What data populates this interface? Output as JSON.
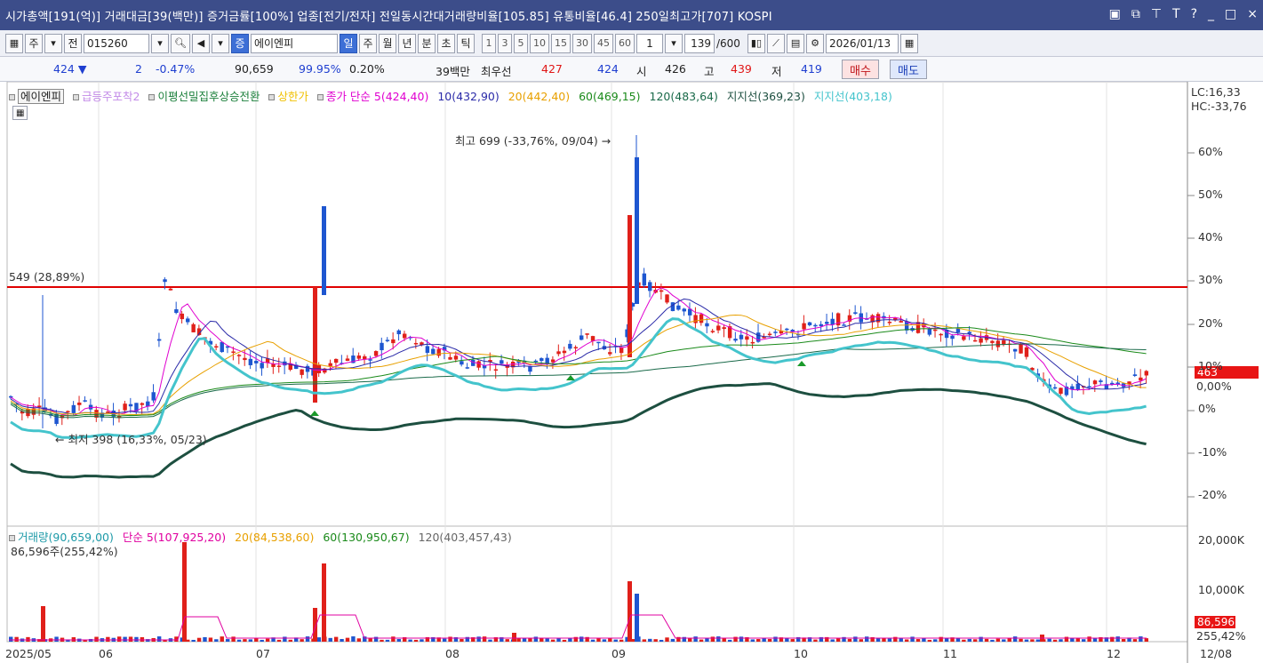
{
  "titlebar": {
    "text": "시가총액[191(억)]  거래대금[39(백만)]  증거금률[100%]  업종[전기/전자]  전일동시간대거래량비율[105.85]  유통비율[46.4]  250일최고가[707]  KOSPI",
    "icons": [
      "window-icon",
      "restore-icon",
      "pin-icon",
      "font-icon",
      "help-icon",
      "minimize-icon",
      "maximize-icon",
      "close-icon"
    ]
  },
  "toolbar": {
    "stock_type": "주",
    "all_label": "전",
    "code": "015260",
    "name": "에이엔피",
    "period_buttons": [
      "일",
      "주",
      "월",
      "년",
      "분",
      "초",
      "틱"
    ],
    "interval_buttons": [
      "1",
      "3",
      "5",
      "10",
      "15",
      "30",
      "45",
      "60"
    ],
    "interval_value": "1",
    "count": "139",
    "count_max": "/600",
    "date": "2026/01/13"
  },
  "quote": {
    "price": "424",
    "change": "2",
    "change_pct": "-0.47%",
    "volume": "90,659",
    "vol_ratio": "99.95%",
    "turnover": "0.20%",
    "amount": "39백만",
    "best_label": "최우선",
    "best_ask": "427",
    "best_bid": "424",
    "open_label": "시",
    "open": "426",
    "high_label": "고",
    "high": "439",
    "low_label": "저",
    "low": "419",
    "buy_label": "매수",
    "sell_label": "매도"
  },
  "legend": {
    "stock": "에이엔피",
    "items": [
      {
        "text": "급등주포착2",
        "color": "#c38be8"
      },
      {
        "text": "이평선밀집후상승전환",
        "color": "#1a7f3a"
      },
      {
        "text": "상한가",
        "color": "#f0c000"
      },
      {
        "text": "종가 단순 5(424,40)",
        "color": "#e000d0"
      },
      {
        "text": "10(432,90)",
        "color": "#2a2aa8"
      },
      {
        "text": "20(442,40)",
        "color": "#e8a000"
      },
      {
        "text": "60(469,15)",
        "color": "#1a8a1a"
      },
      {
        "text": "120(483,64)",
        "color": "#1a6a4a"
      },
      {
        "text": "지지선(369,23)",
        "color": "#1d4f40"
      },
      {
        "text": "지지선(403,18)",
        "color": "#44c4cc"
      }
    ],
    "lc": "LC:16,33",
    "hc": "HC:-33,76"
  },
  "annotations": {
    "high_label": "최고 699 (-33,76%, 09/04)",
    "low_label": "최저 398 (16,33%, 05/23)",
    "line_label": "549 (28,89%)",
    "price_tag": "463",
    "pct_tag": "0,00%"
  },
  "volume_legend": {
    "items": [
      {
        "text": "거래량(90,659,00)",
        "color": "#1d9aa8"
      },
      {
        "text": "단순 5(107,925,20)",
        "color": "#e000a0"
      },
      {
        "text": "20(84,538,60)",
        "color": "#e8a000"
      },
      {
        "text": "60(130,950,67)",
        "color": "#1a8a1a"
      },
      {
        "text": "120(403,457,43)",
        "color": "#666666"
      }
    ],
    "sub": "86,596주(255,42%)",
    "vol_tag": "86,596",
    "vol_pct_tag": "255,42%"
  },
  "chart_data": {
    "type": "line",
    "y_axis_percent": [
      "60%",
      "50%",
      "40%",
      "30%",
      "20%",
      "10%",
      "0%",
      "-10%",
      "-20%"
    ],
    "volume_axis": [
      "20,000K",
      "10,000K"
    ],
    "x_labels": [
      "2025/05",
      "06",
      "07",
      "08",
      "09",
      "10",
      "11",
      "12",
      "12/08"
    ],
    "resistance_line": 549,
    "high": 699,
    "low": 398
  },
  "colors": {
    "up": "#e0201a",
    "down": "#1e56d0",
    "ma5": "#e000d0",
    "ma10": "#2a2aa8",
    "ma20": "#e8a000",
    "ma60": "#1a8a1a",
    "ma120": "#1a6a4a",
    "support1": "#1d4f40",
    "support2": "#44c4cc",
    "resistance": "#e00000"
  }
}
